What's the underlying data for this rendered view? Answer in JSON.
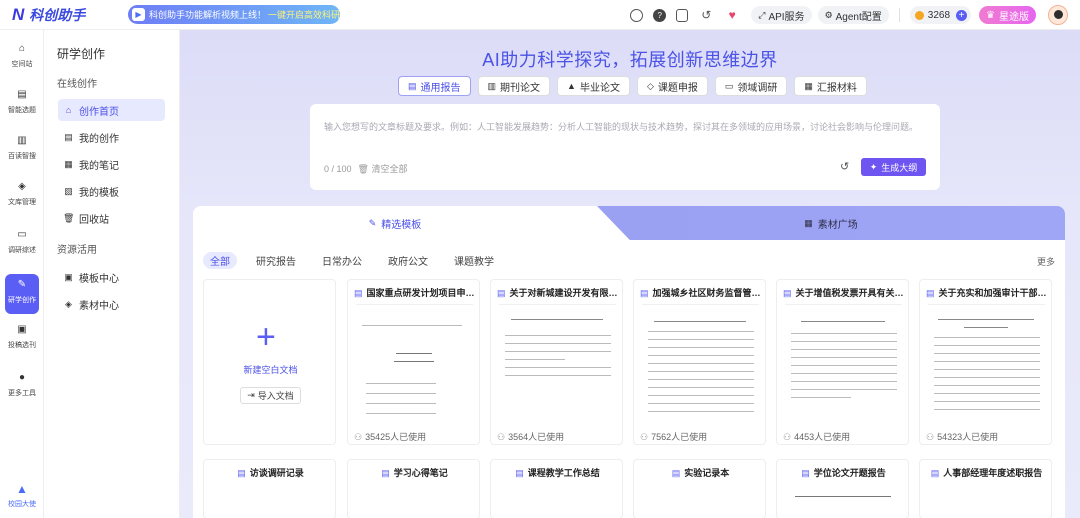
{
  "app": {
    "logo_mark": "N",
    "name": "科创助手"
  },
  "banner": {
    "text": "科创助手功能解析视频上线！",
    "link": "一键开启高效科研~"
  },
  "topbar": {
    "api_label": "API服务",
    "agent_label": "Agent配置",
    "points": "3268",
    "vip_label": "星途版"
  },
  "rail": [
    {
      "label": "空间站",
      "icon": "home-icon"
    },
    {
      "label": "智能选题",
      "icon": "clipboard-icon"
    },
    {
      "label": "百读智搜",
      "icon": "book-search-icon"
    },
    {
      "label": "文库管理",
      "icon": "cube-icon"
    },
    {
      "label": "调研综述",
      "icon": "open-book-icon"
    },
    {
      "label": "研学创作",
      "icon": "pen-icon"
    },
    {
      "label": "投稿选刊",
      "icon": "save-icon"
    },
    {
      "label": "更多工具",
      "icon": "more-icon"
    },
    {
      "label": "校园大使",
      "icon": "graduation-cap-icon"
    }
  ],
  "sidebar": {
    "title": "研学创作",
    "group1": "在线创作",
    "items1": [
      "创作首页",
      "我的创作",
      "我的笔记",
      "我的模板",
      "回收站"
    ],
    "group2": "资源活用",
    "items2": [
      "模板中心",
      "素材中心"
    ]
  },
  "hero": {
    "title": "AI助力科学探究，拓展创新思维边界"
  },
  "tabs": [
    "通用报告",
    "期刊论文",
    "毕业论文",
    "课题申报",
    "领域调研",
    "汇报材料"
  ],
  "input": {
    "placeholder": "输入您想写的文章标题及要求。例如：人工智能发展趋势：分析人工智能的现状与技术趋势，探讨其在多领域的应用场景，讨论社会影响与伦理问题。",
    "count": "0 / 100",
    "clear": "清空全部",
    "generate": "生成大纲"
  },
  "panel": {
    "tab_left": "精选模板",
    "tab_right": "素材广场",
    "filters": [
      "全部",
      "研究报告",
      "日常办公",
      "政府公文",
      "课题教学"
    ],
    "more": "更多",
    "new_doc": "新建空白文档",
    "import_doc": "导入文档",
    "cards": [
      {
        "title": "国家重点研发计划项目申报...",
        "uses": "35425人已使用"
      },
      {
        "title": "关于对新城建设开发有限公...",
        "uses": "3564人已使用"
      },
      {
        "title": "加强城乡社区财务监督管理...",
        "uses": "7562人已使用"
      },
      {
        "title": "关于增值税发票开具有关问...",
        "uses": "4453人已使用"
      },
      {
        "title": "关于充实和加强审计干部队...",
        "uses": "54323人已使用"
      }
    ],
    "cards2": [
      "访谈调研记录",
      "学习心得笔记",
      "课程教学工作总结",
      "实验记录本",
      "学位论文开题报告",
      "人事部经理年度述职报告"
    ]
  },
  "colors": {
    "accent": "#5b5ef4",
    "hero": "#4b52e6",
    "vip": "#e666f0"
  }
}
